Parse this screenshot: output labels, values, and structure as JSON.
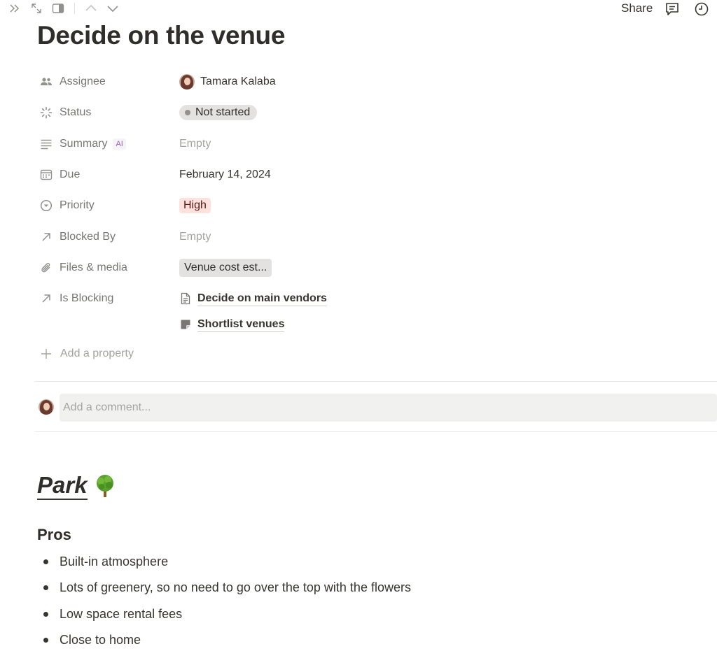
{
  "page": {
    "title": "Decide on the venue"
  },
  "topbar": {
    "share_label": "Share",
    "icons": [
      "double-chevron-right-icon",
      "expand-icon",
      "side-peek-icon",
      "chevron-up-icon",
      "chevron-down-icon",
      "comment-icon",
      "clock-icon"
    ]
  },
  "properties": {
    "assignee": {
      "label": "Assignee",
      "value": "Tamara Kalaba"
    },
    "status": {
      "label": "Status",
      "value": "Not started"
    },
    "summary": {
      "label": "Summary",
      "badge": "AI",
      "value": "Empty"
    },
    "due": {
      "label": "Due",
      "value": "February 14, 2024"
    },
    "priority": {
      "label": "Priority",
      "value": "High"
    },
    "blocked_by": {
      "label": "Blocked By",
      "value": "Empty"
    },
    "files": {
      "label": "Files & media",
      "value": "Venue cost est..."
    },
    "is_blocking": {
      "label": "Is Blocking",
      "items": [
        "Decide on main vendors",
        "Shortlist venues"
      ]
    }
  },
  "add_property_label": "Add a property",
  "comment": {
    "placeholder": "Add a comment..."
  },
  "content": {
    "heading": "Park",
    "subheading": "Pros",
    "bullets": [
      "Built-in atmosphere",
      "Lots of greenery, so no need to go over the top with the flowers",
      "Low space rental fees",
      "Close to home"
    ]
  },
  "colors": {
    "status_bg": "#e3e2e0",
    "priority_bg": "#ffe2dd",
    "priority_text": "#5d1715",
    "ai_badge": "#9065b0"
  }
}
